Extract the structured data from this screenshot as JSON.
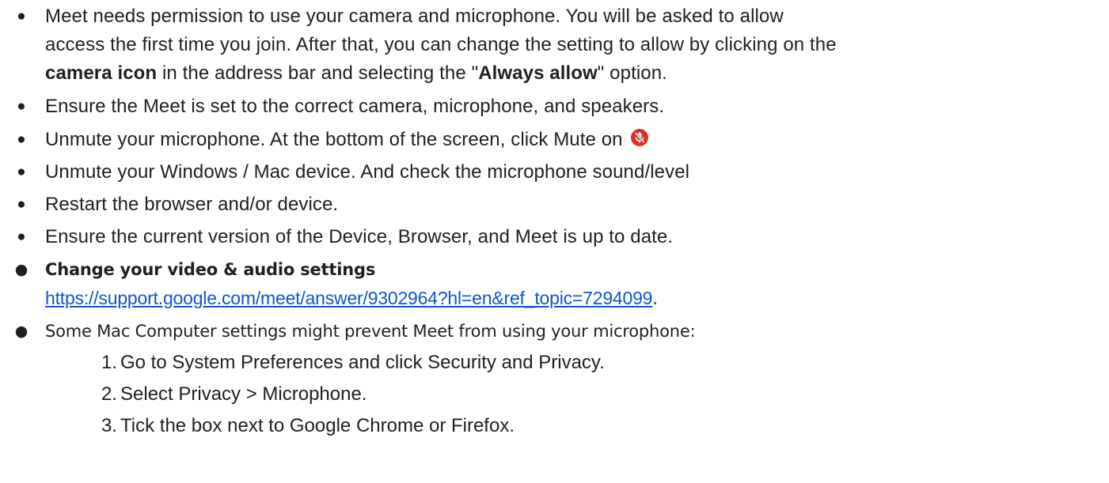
{
  "bullets": {
    "b1": {
      "line1": "Meet needs permission to use your camera and microphone.  You will be asked to allow",
      "line2": "access the first time you join. After that, you can change the setting to allow by clicking on the",
      "bold1": "camera icon",
      "mid": " in the address bar and selecting the \"",
      "bold2": "Always allow",
      "end": "\" option."
    },
    "b2": "Ensure the Meet is set to the correct camera, microphone, and speakers.",
    "b3": "Unmute your microphone. At the bottom of the screen, click Mute on",
    "b4": "Unmute your Windows / Mac device. And check the microphone sound/level",
    "b5": "Restart the browser and/or device.",
    "b6": "Ensure the current version of the Device, Browser, and Meet is up to date.",
    "b7": {
      "title": "Change your video & audio settings",
      "link": "https://support.google.com/meet/answer/9302964?hl=en&ref_topic=7294099",
      "after": "."
    },
    "b8": "Some Mac Computer settings might prevent Meet from using your microphone:"
  },
  "steps": [
    {
      "num": "1.",
      "text": "Go to System Preferences and click Security and Privacy."
    },
    {
      "num": "2.",
      "text": "Select Privacy > Microphone."
    },
    {
      "num": "3.",
      "text": "Tick the box next to Google Chrome or Firefox."
    }
  ],
  "bullet_glyph": "●",
  "icons": {
    "mute": "mic-off-icon"
  },
  "colors": {
    "text": "#1f1f1f",
    "link": "#1155cc",
    "mute_icon": "#d93025"
  }
}
